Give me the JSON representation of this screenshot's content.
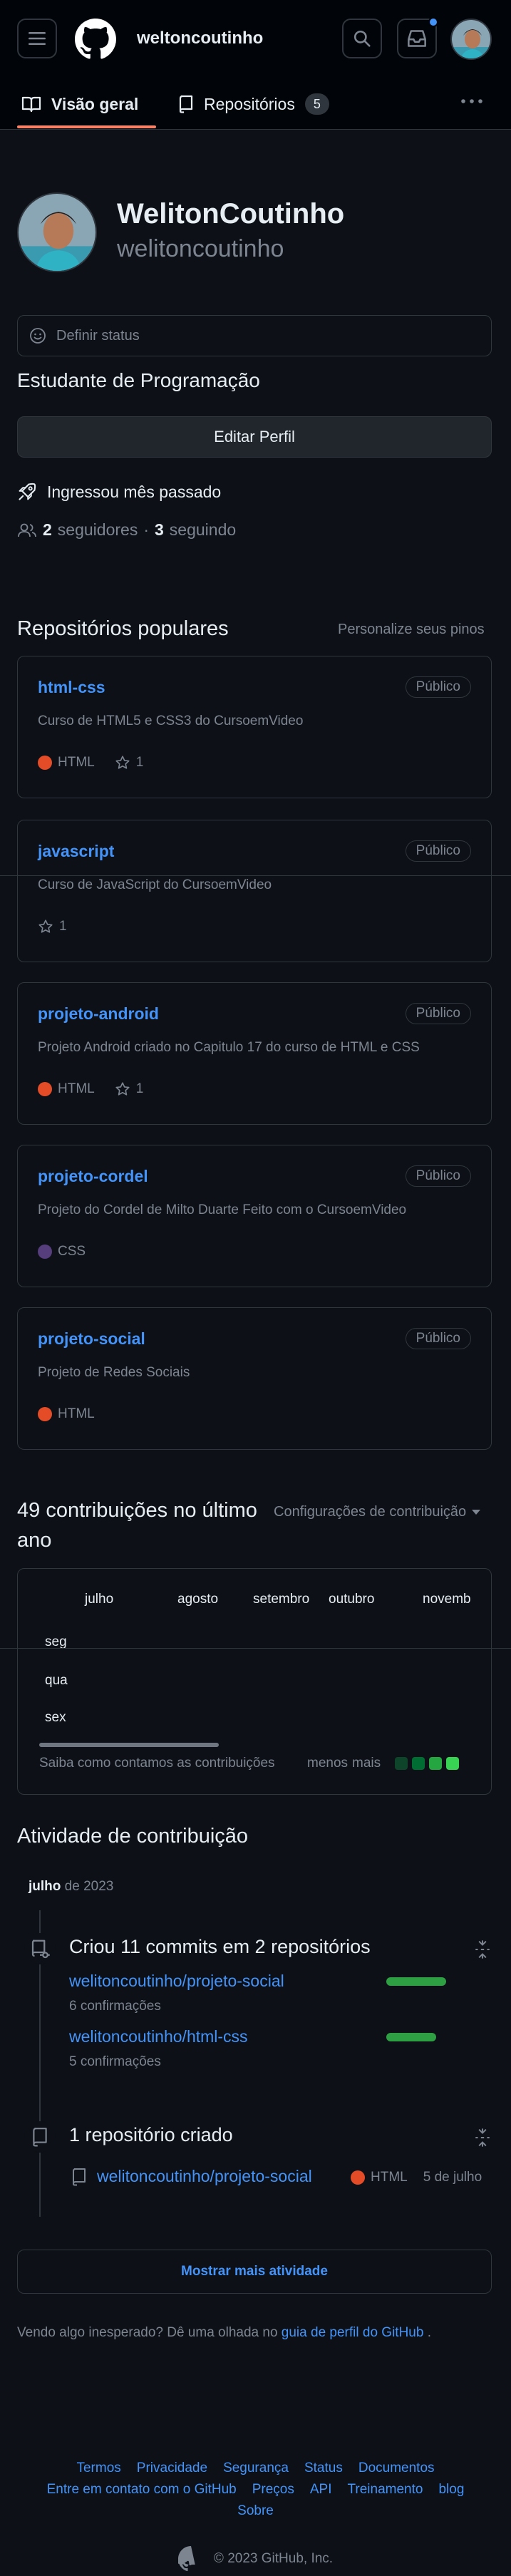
{
  "header": {
    "username": "weltoncoutinho",
    "icons": [
      "menu-icon",
      "github-logo-icon",
      "search-icon",
      "inbox-icon",
      "avatar"
    ]
  },
  "tabs": [
    {
      "label": "Visão geral",
      "icon": "book-icon",
      "active": true
    },
    {
      "label": "Repositórios",
      "icon": "repo-icon",
      "count": "5"
    }
  ],
  "profile": {
    "name": "WelitonCoutinho",
    "login": "welitoncoutinho",
    "status_placeholder": "Definir status",
    "bio": "Estudante de Programação",
    "edit_label": "Editar Perfil",
    "joined": "Ingressou mês passado",
    "followers_count": "2",
    "followers_label": "seguidores",
    "separator": "·",
    "following_count": "3",
    "following_label": "seguindo"
  },
  "popular": {
    "title": "Repositórios populares",
    "customize_label": "Personalize seus pinos",
    "repos": [
      {
        "name": "html-css",
        "visibility": "Público",
        "description": "Curso de HTML5 e CSS3 do CursoemVideo",
        "language": "HTML",
        "lang_color": "#e34c26",
        "stars": "1"
      },
      {
        "name": "javascript",
        "visibility": "Público",
        "description": "Curso de JavaScript do CursoemVideo",
        "language": "",
        "lang_color": "",
        "stars": "1"
      },
      {
        "name": "projeto-android",
        "visibility": "Público",
        "description": "Projeto Android criado no Capitulo 17 do curso de HTML e CSS",
        "language": "HTML",
        "lang_color": "#e34c26",
        "stars": "1"
      },
      {
        "name": "projeto-cordel",
        "visibility": "Público",
        "description": "Projeto do Cordel de Milto Duarte Feito com o CursoemVideo",
        "language": "CSS",
        "lang_color": "#563d7c",
        "stars": ""
      },
      {
        "name": "projeto-social",
        "visibility": "Público",
        "description": "Projeto de Redes Sociais",
        "language": "HTML",
        "lang_color": "#e34c26",
        "stars": ""
      }
    ]
  },
  "contributions": {
    "title": "49 contribuições no último ano",
    "settings_label": "Configurações de contribuição",
    "months": [
      "julho",
      "agosto",
      "setembro",
      "outubro",
      "novemb"
    ],
    "days": [
      "seg",
      "qua",
      "sex"
    ],
    "learn_label": "Saiba como contamos as contribuições",
    "less_label": "menos",
    "more_label": "mais",
    "legend_colors": [
      "#0e4429",
      "#006d32",
      "#26a641",
      "#39d353"
    ]
  },
  "activity": {
    "title": "Atividade de contribuição",
    "month": "julho",
    "year": "de 2023",
    "commits_title": "Criou 11 commits em 2 repositórios",
    "commit_repos": [
      {
        "name": "welitoncoutinho/projeto-social",
        "count_label": "6 confirmações",
        "share": 6
      },
      {
        "name": "welitoncoutinho/html-css",
        "count_label": "5 confirmações",
        "share": 5
      }
    ],
    "created_title": "1 repositório criado",
    "created_repo": "welitoncoutinho/projeto-social",
    "created_language": "HTML",
    "created_lang_color": "#e34c26",
    "created_date": "5 de julho",
    "show_more": "Mostrar mais atividade",
    "unexpected_prefix": "Vendo algo inesperado? Dê uma olhada no",
    "unexpected_link": "guia de perfil do GitHub",
    "unexpected_suffix": "."
  },
  "footer": {
    "links": [
      "Termos",
      "Privacidade",
      "Segurança",
      "Status",
      "Documentos",
      "Entre em contato com o GitHub",
      "Preços",
      "API",
      "Treinamento",
      "blog",
      "Sobre"
    ],
    "copyright": "© 2023 GitHub, Inc."
  }
}
